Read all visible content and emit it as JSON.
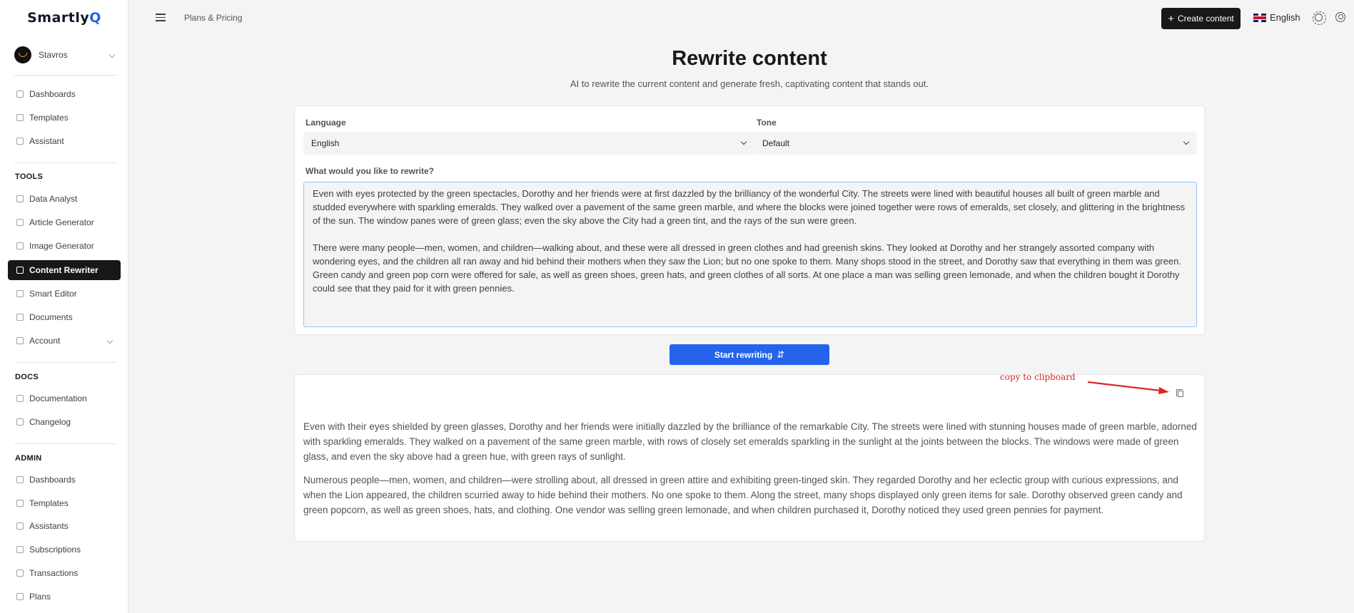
{
  "app": {
    "logo_main": "Smartly",
    "logo_accent": "Q"
  },
  "user": {
    "name": "Stavros"
  },
  "sidebar": {
    "main_items": [
      {
        "label": "Dashboards"
      },
      {
        "label": "Templates"
      },
      {
        "label": "Assistant"
      }
    ],
    "tools_heading": "TOOLS",
    "tools_items": [
      {
        "label": "Data Analyst"
      },
      {
        "label": "Article Generator"
      },
      {
        "label": "Image Generator"
      },
      {
        "label": "Content Rewriter"
      },
      {
        "label": "Smart Editor"
      },
      {
        "label": "Documents"
      },
      {
        "label": "Account"
      }
    ],
    "docs_heading": "DOCS",
    "docs_items": [
      {
        "label": "Documentation"
      },
      {
        "label": "Changelog"
      }
    ],
    "admin_heading": "ADMIN",
    "admin_items": [
      {
        "label": "Dashboards"
      },
      {
        "label": "Templates"
      },
      {
        "label": "Assistants"
      },
      {
        "label": "Subscriptions"
      },
      {
        "label": "Transactions"
      },
      {
        "label": "Plans"
      }
    ]
  },
  "topbar": {
    "breadcrumb": "Plans & Pricing",
    "create_button": "Create content",
    "language": "English"
  },
  "main": {
    "title": "Rewrite content",
    "subtitle": "AI to rewrite the current content and generate fresh, captivating content that stands out.",
    "language_label": "Language",
    "language_value": "English",
    "tone_label": "Tone",
    "tone_value": "Default",
    "input_label": "What would you like to rewrite?",
    "input_paragraphs": [
      "Even with eyes protected by the green spectacles, Dorothy and her friends were at first dazzled by the brilliancy of the wonderful City. The streets were lined with beautiful houses all built of green marble and studded everywhere with sparkling emeralds. They walked over a pavement of the same green marble, and where the blocks were joined together were rows of emeralds, set closely, and glittering in the brightness of the sun. The window panes were of green glass; even the sky above the City had a green tint, and the rays of the sun were green.",
      "There were many people—men, women, and children—walking about, and these were all dressed in green clothes and had greenish skins. They looked at Dorothy and her strangely assorted company with wondering eyes, and the children all ran away and hid behind their mothers when they saw the Lion; but no one spoke to them. Many shops stood in the street, and Dorothy saw that everything in them was green. Green candy and green pop corn were offered for sale, as well as green shoes, green hats, and green clothes of all sorts. At one place a man was selling green lemonade, and when the children bought it Dorothy could see that they paid for it with green pennies."
    ],
    "start_button": "Start rewriting",
    "swap_glyph": "⇵",
    "result_paragraphs": [
      "Even with their eyes shielded by green glasses, Dorothy and her friends were initially dazzled by the brilliance of the remarkable City. The streets were lined with stunning houses made of green marble, adorned with sparkling emeralds. They walked on a pavement of the same green marble, with rows of closely set emeralds sparkling in the sunlight at the joints between the blocks. The windows were made of green glass, and even the sky above had a green hue, with green rays of sunlight.",
      "Numerous people—men, women, and children—were strolling about, all dressed in green attire and exhibiting green-tinged skin. They regarded Dorothy and her eclectic group with curious expressions, and when the Lion appeared, the children scurried away to hide behind their mothers. No one spoke to them. Along the street, many shops displayed only green items for sale. Dorothy observed green candy and green popcorn, as well as green shoes, hats, and clothing. One vendor was selling green lemonade, and when children purchased it, Dorothy noticed they used green pennies for payment."
    ],
    "annotation": "copy to clipboard"
  },
  "colors": {
    "accent": "#2563eb",
    "dark": "#18181b",
    "annotation": "#dc2626"
  }
}
